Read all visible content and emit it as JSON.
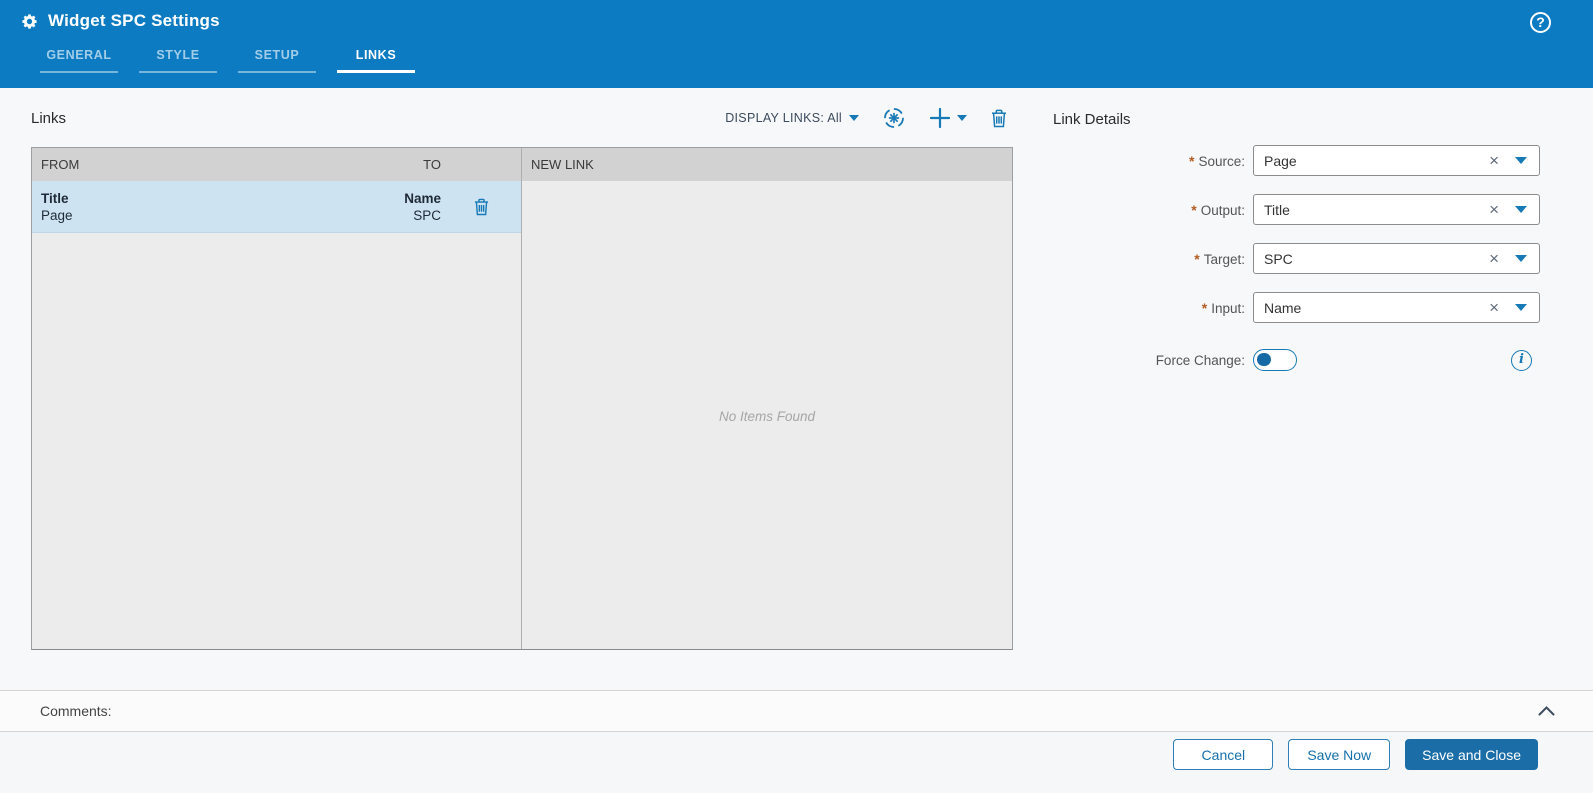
{
  "required_marker": "*",
  "titlebar": {
    "title": "Widget SPC Settings",
    "help_glyph": "?"
  },
  "tabs": [
    {
      "label": "GENERAL"
    },
    {
      "label": "STYLE"
    },
    {
      "label": "SETUP"
    },
    {
      "label": "LINKS"
    }
  ],
  "links_section": {
    "title": "Links",
    "toolbar": {
      "display_links_label": "DISPLAY LINKS: All"
    },
    "table": {
      "columns": {
        "from": "FROM",
        "to": "TO"
      },
      "rows": [
        {
          "from_top": "Title",
          "from_bottom": "Page",
          "to_top": "Name",
          "to_bottom": "SPC",
          "selected": true
        }
      ]
    },
    "new_link_panel": {
      "header": "NEW LINK",
      "empty_text": "No Items Found"
    }
  },
  "link_details": {
    "title": "Link Details",
    "fields": [
      {
        "label": "Source:",
        "value": "Page"
      },
      {
        "label": "Output:",
        "value": "Title"
      },
      {
        "label": "Target:",
        "value": "SPC"
      },
      {
        "label": "Input:",
        "value": "Name"
      }
    ],
    "force_change_label": "Force Change:",
    "force_change_enabled": false,
    "info_glyph": "i"
  },
  "comments": {
    "label": "Comments:"
  },
  "footer": {
    "cancel_label": "Cancel",
    "save_now_label": "Save Now",
    "save_close_label": "Save and Close"
  },
  "colors": {
    "header_blue": "#0c7bc2",
    "accent_blue": "#1779b5",
    "selected_row": "#cde3f2",
    "primary_button": "#1a6da6",
    "required_asterisk": "#b25d25"
  }
}
